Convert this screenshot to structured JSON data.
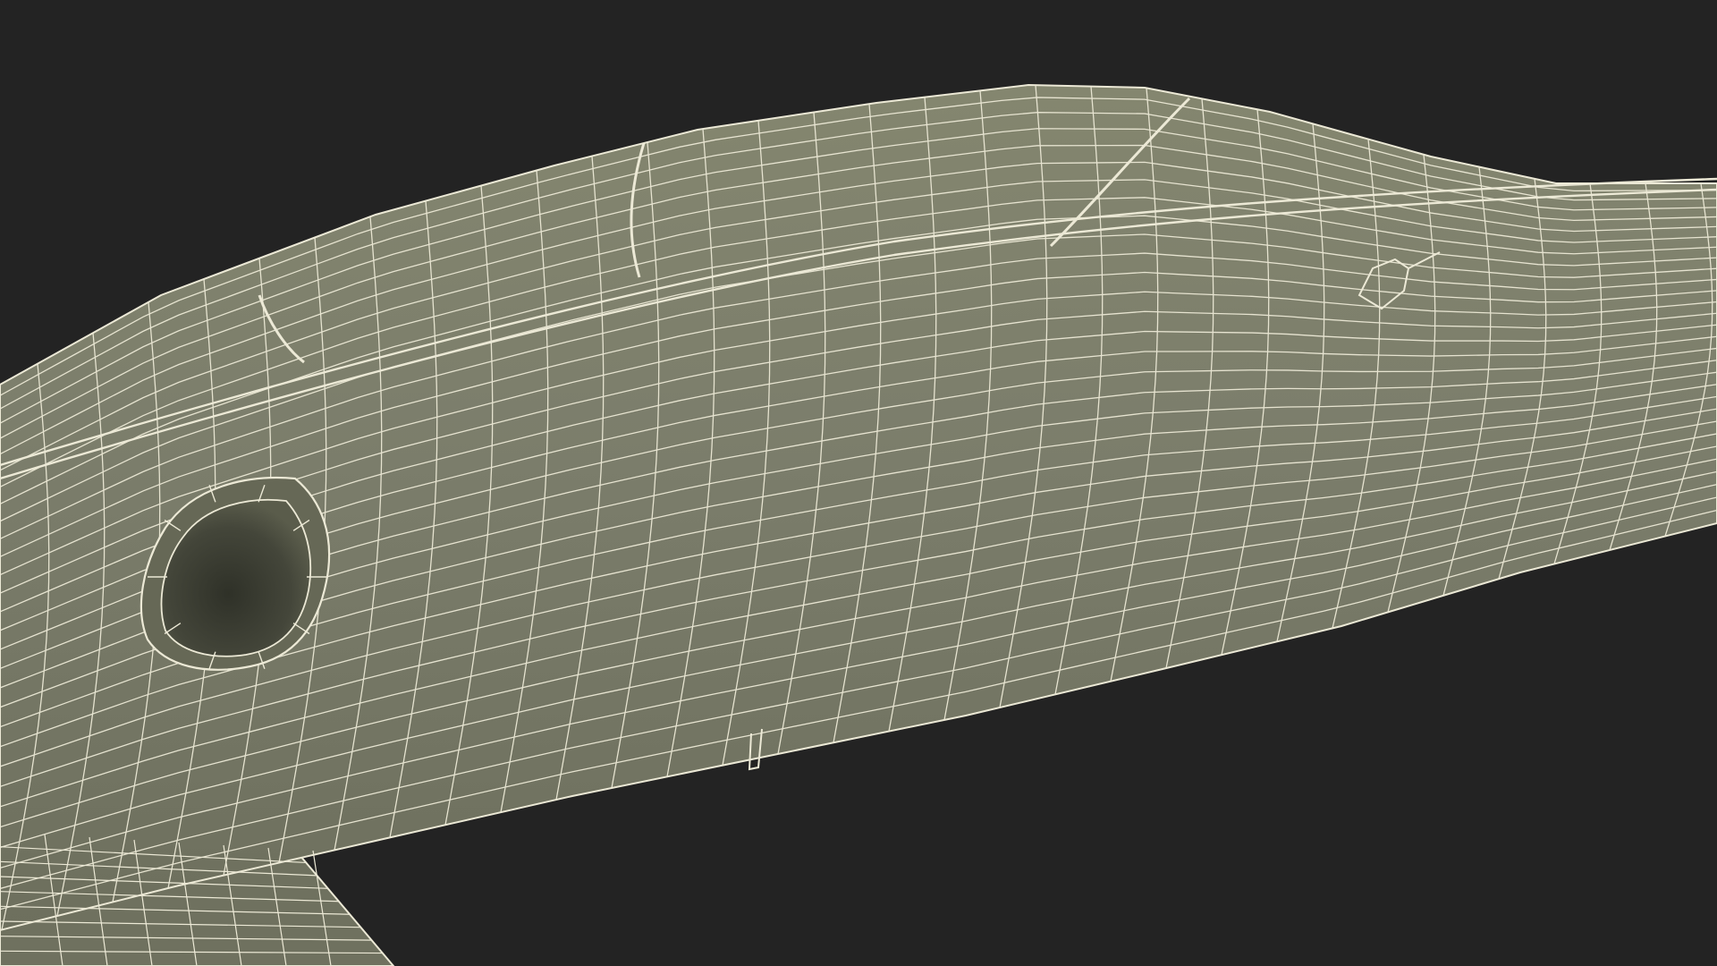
{
  "scene": {
    "subject": "wireframe-aircraft-fuselage",
    "colors": {
      "background": "#232323",
      "surface": "#7b7d6b",
      "surface_shade": "#666856",
      "intake_dark": "#3d3f34",
      "wire": "#ece9d6"
    }
  }
}
